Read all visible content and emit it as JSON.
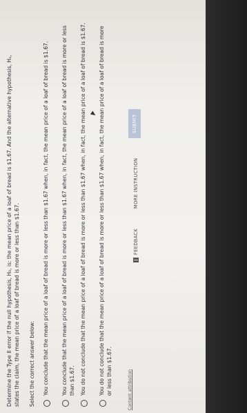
{
  "question": {
    "text": "Determine the Type II error if the null hypothesis, H₀, is: the mean price of a loaf of bread is $1.67. And the alternative hypothesis, Hₐ, states the claim, the mean price of a loaf of bread is more or less than $1.67."
  },
  "prompt": "Select the correct answer below:",
  "options": [
    {
      "text": "You conclude that the mean price of a loaf of bread is more or less than $1.67 when, in fact, the mean price of a loaf of bread is $1.67."
    },
    {
      "text": "You conclude that the mean price of a loaf of bread is more or less than $1.67 when, in fact, the mean price of a loaf of bread is more or less than $1.67."
    },
    {
      "text": "You do not conclude that the mean price of a loaf of bread is more or less than $1.67 when, in fact, the mean price of a loaf of bread is $1.67."
    },
    {
      "text": "You do not conclude that the mean price of a loaf of bread is more or less than $1.67 when, in fact, the mean price of a loaf of bread is more or less than $1.67."
    }
  ],
  "attribution": "Content attribution",
  "toolbar": {
    "feedback_label": "FEEDBACK",
    "more_instruction_label": "MORE INSTRUCTION",
    "submit_label": "SUBMIT"
  },
  "icons": {
    "feedback": "book-icon",
    "cursor": "mouse-cursor-icon"
  },
  "colors": {
    "submit_bg": "#b8c3d6",
    "text": "#2f2f33"
  }
}
